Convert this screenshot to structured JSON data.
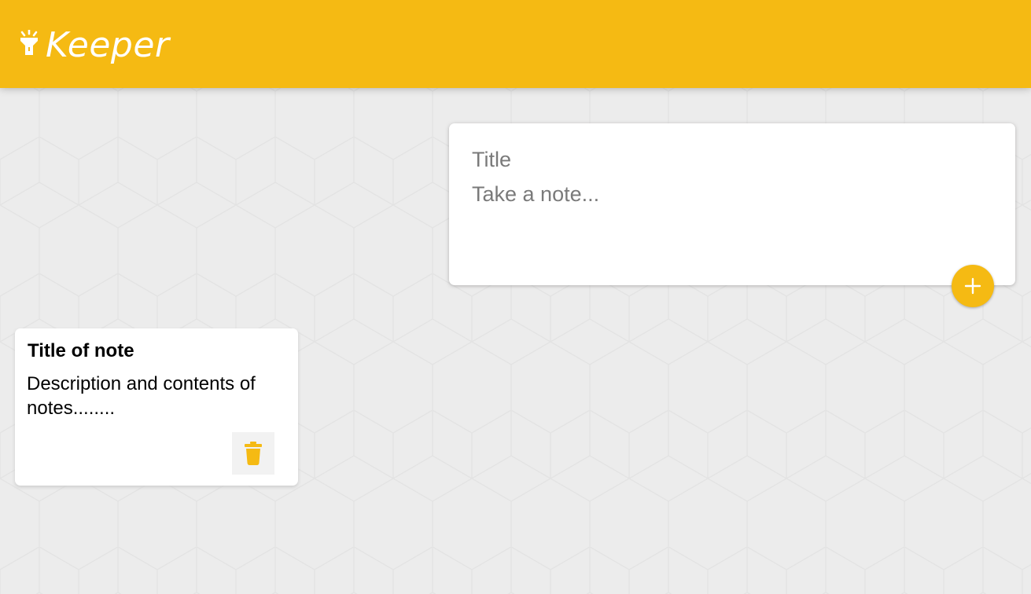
{
  "header": {
    "app_title": "Keeper",
    "logo_icon": "flashlight-icon"
  },
  "create_note": {
    "title_placeholder": "Title",
    "content_placeholder": "Take a note...",
    "title_value": "",
    "content_value": "",
    "add_icon": "plus-icon"
  },
  "notes": [
    {
      "title": "Title of note",
      "content": "Description and contents of notes........",
      "delete_icon": "trash-icon"
    }
  ],
  "colors": {
    "accent": "#f5ba13",
    "background": "#ececec",
    "card": "#ffffff"
  }
}
